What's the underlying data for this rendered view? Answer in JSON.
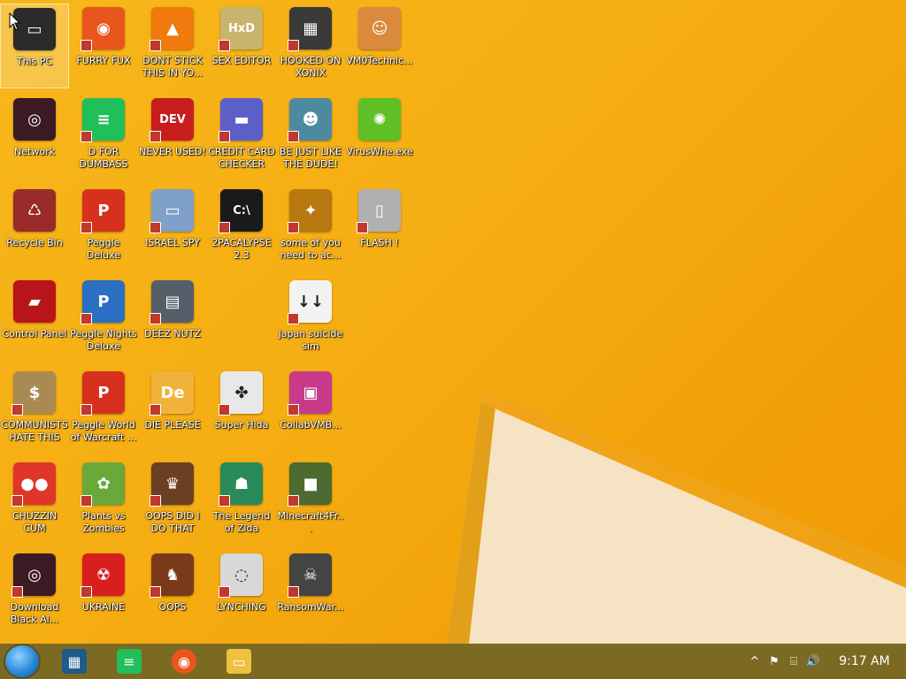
{
  "desktop": {
    "icons": [
      {
        "label": "This PC",
        "glyph": "▭",
        "color": "#2b2b2b",
        "col": 0,
        "row": 0,
        "selected": true,
        "shortcut": false
      },
      {
        "label": "FURRY FUX",
        "glyph": "◉",
        "color": "#e8561d",
        "col": 1,
        "row": 0,
        "shortcut": true
      },
      {
        "label": "DONT STICK THIS IN YO...",
        "glyph": "▲",
        "color": "#f07a0c",
        "col": 2,
        "row": 0,
        "shortcut": true
      },
      {
        "label": "SEX EDITOR",
        "glyph": "HxD",
        "color": "#c8b46c",
        "col": 3,
        "row": 0,
        "shortcut": true
      },
      {
        "label": "HOOKED ON XONIX",
        "glyph": "▦",
        "color": "#3a3a3a",
        "col": 4,
        "row": 0,
        "shortcut": true
      },
      {
        "label": "VM0Technic...",
        "glyph": "☺",
        "color": "#d98a3a",
        "col": 5,
        "row": 0,
        "shortcut": false
      },
      {
        "label": "Network",
        "glyph": "◎",
        "color": "#3b1a24",
        "col": 0,
        "row": 1,
        "shortcut": false
      },
      {
        "label": "D FOR DUMBASS",
        "glyph": "≡",
        "color": "#1fbf5a",
        "col": 1,
        "row": 1,
        "shortcut": true
      },
      {
        "label": "NEVER USED!",
        "glyph": "DEV",
        "color": "#c81d1d",
        "col": 2,
        "row": 1,
        "shortcut": true
      },
      {
        "label": "CREDIT CARD CHECKER",
        "glyph": "▬",
        "color": "#5d5fc9",
        "col": 3,
        "row": 1,
        "shortcut": true
      },
      {
        "label": "BE JUST LIKE THE DUDE!",
        "glyph": "☻",
        "color": "#4d8aa0",
        "col": 4,
        "row": 1,
        "shortcut": true
      },
      {
        "label": "VirusWhe.exe",
        "glyph": "✺",
        "color": "#5fbf24",
        "col": 5,
        "row": 1,
        "shortcut": false
      },
      {
        "label": "Recycle Bin",
        "glyph": "♺",
        "color": "#9a2b2b",
        "col": 0,
        "row": 2,
        "shortcut": false
      },
      {
        "label": "Peggle Deluxe",
        "glyph": "P",
        "color": "#d8301f",
        "col": 1,
        "row": 2,
        "shortcut": true
      },
      {
        "label": "ISRAEL SPY",
        "glyph": "▭",
        "color": "#7fa0c8",
        "col": 2,
        "row": 2,
        "shortcut": true
      },
      {
        "label": "2PACALYPSE 2.3",
        "glyph": "C:\\",
        "color": "#1a1a1a",
        "col": 3,
        "row": 2,
        "shortcut": true
      },
      {
        "label": "some of you need to ac...",
        "glyph": "✦",
        "color": "#b8770f",
        "col": 4,
        "row": 2,
        "shortcut": true
      },
      {
        "label": "FLASH !",
        "glyph": "▯",
        "color": "#b0b0b0",
        "col": 5,
        "row": 2,
        "shortcut": true
      },
      {
        "label": "Control Panel",
        "glyph": "▰",
        "color": "#b8151a",
        "col": 0,
        "row": 3,
        "shortcut": false
      },
      {
        "label": "Peggle Nights Deluxe",
        "glyph": "P",
        "color": "#2a6fc1",
        "col": 1,
        "row": 3,
        "shortcut": true
      },
      {
        "label": "DEEZ NUTZ",
        "glyph": "▤",
        "color": "#555f6a",
        "col": 2,
        "row": 3,
        "shortcut": true
      },
      {
        "label": "japan suicide sim",
        "glyph": "↓↓",
        "color": "#f2f2f2",
        "col": 4,
        "row": 3,
        "shortcut": true
      },
      {
        "label": "COMMUNISTS HATE THIS G...",
        "glyph": "$",
        "color": "#a98a55",
        "col": 0,
        "row": 4,
        "shortcut": true
      },
      {
        "label": "Peggle World of Warcraft ...",
        "glyph": "P",
        "color": "#d8301f",
        "col": 1,
        "row": 4,
        "shortcut": true
      },
      {
        "label": "DIE PLEASE",
        "glyph": "De",
        "color": "#f2b23a",
        "col": 2,
        "row": 4,
        "shortcut": true
      },
      {
        "label": "Super Hida",
        "glyph": "✤",
        "color": "#e8e8e8",
        "col": 3,
        "row": 4,
        "shortcut": true
      },
      {
        "label": "CollabVMB...",
        "glyph": "▣",
        "color": "#c73a8a",
        "col": 4,
        "row": 4,
        "shortcut": true
      },
      {
        "label": "CHUZZIN CUM",
        "glyph": "●●",
        "color": "#e0352a",
        "col": 0,
        "row": 5,
        "shortcut": true
      },
      {
        "label": "Plants vs Zombies",
        "glyph": "✿",
        "color": "#6aa83a",
        "col": 1,
        "row": 5,
        "shortcut": true
      },
      {
        "label": "OOPS DID I DO THAT",
        "glyph": "♛",
        "color": "#6b3f22",
        "col": 2,
        "row": 5,
        "shortcut": true
      },
      {
        "label": "The Legend of Zlda",
        "glyph": "☗",
        "color": "#2a8a5a",
        "col": 3,
        "row": 5,
        "shortcut": true
      },
      {
        "label": "Minecraft4Fr...",
        "glyph": "■",
        "color": "#4d6a30",
        "col": 4,
        "row": 5,
        "shortcut": true
      },
      {
        "label": "Download Black Al...",
        "glyph": "◎",
        "color": "#3b1a24",
        "col": 0,
        "row": 6,
        "shortcut": true
      },
      {
        "label": "UKRAINE",
        "glyph": "☢",
        "color": "#d81e1e",
        "col": 1,
        "row": 6,
        "shortcut": true
      },
      {
        "label": "OOPS",
        "glyph": "♞",
        "color": "#7a3a1a",
        "col": 2,
        "row": 6,
        "shortcut": true
      },
      {
        "label": "LYNCHING",
        "glyph": "◌",
        "color": "#d8d8d8",
        "col": 3,
        "row": 6,
        "shortcut": true
      },
      {
        "label": "RansomWar...",
        "glyph": "☠",
        "color": "#444444",
        "col": 4,
        "row": 6,
        "shortcut": true
      }
    ]
  },
  "taskbar": {
    "apps": [
      {
        "name": "task-view",
        "glyph": "▦",
        "color": "#1e5a8a"
      },
      {
        "name": "green-app",
        "glyph": "≡",
        "color": "#1fbf5a"
      },
      {
        "name": "firefox",
        "glyph": "◉",
        "color": "#e8561d"
      },
      {
        "name": "file-explorer",
        "glyph": "▭",
        "color": "#f0c040"
      }
    ],
    "tray": {
      "chevron": "^",
      "flag": "⚑",
      "network": "⌸",
      "volume": "🔊",
      "clock": "9:17 AM"
    }
  },
  "colors": {
    "wallpaper_main": "#f5ad12",
    "wallpaper_light": "#f9e6c4",
    "taskbar": "#7d6a22"
  }
}
